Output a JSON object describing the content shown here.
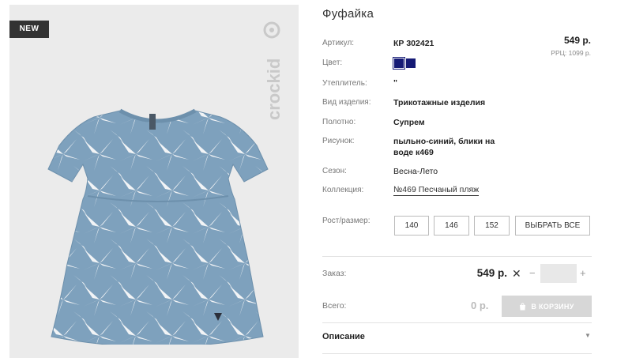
{
  "image": {
    "badge": "NEW",
    "brand": "crockid",
    "colors": {
      "background": "#ebebeb",
      "dress": "#7ea1bd",
      "pattern": "#f2f4f6"
    }
  },
  "product": {
    "title": "Фуфайка",
    "price": "549 р.",
    "rrp": "РРЦ: 1099 р."
  },
  "details": {
    "article_label": "Артикул:",
    "article_value": "КР 302421",
    "color_label": "Цвет:",
    "insulation_label": "Утеплитель:",
    "insulation_value": "\"",
    "type_label": "Вид изделия:",
    "type_value": "Трикотажные изделия",
    "fabric_label": "Полотно:",
    "fabric_value": "Супрем",
    "pattern_label": "Рисунок:",
    "pattern_value_line1": "пыльно-синий, блики на",
    "pattern_value_line2": "воде к469",
    "season_label": "Сезон:",
    "season_value": "Весна-Лето",
    "collection_label": "Коллекция:",
    "collection_value": "№469 Песчаный пляж"
  },
  "swatches": [
    {
      "color": "#151a75",
      "selected": true
    },
    {
      "color": "#151a75",
      "selected": false
    }
  ],
  "sizes": {
    "label": "Рост/размер:",
    "options": [
      "140",
      "146",
      "152"
    ],
    "select_all": "ВЫБРАТЬ ВСЕ"
  },
  "order": {
    "label": "Заказ:",
    "price": "549 р.",
    "times": "✕",
    "minus": "−",
    "plus": "+",
    "quantity": ""
  },
  "total": {
    "label": "Всего:",
    "value": "0 р.",
    "cart_button": "В КОРЗИНУ"
  },
  "description": {
    "title": "Описание",
    "arrow": "▼"
  }
}
